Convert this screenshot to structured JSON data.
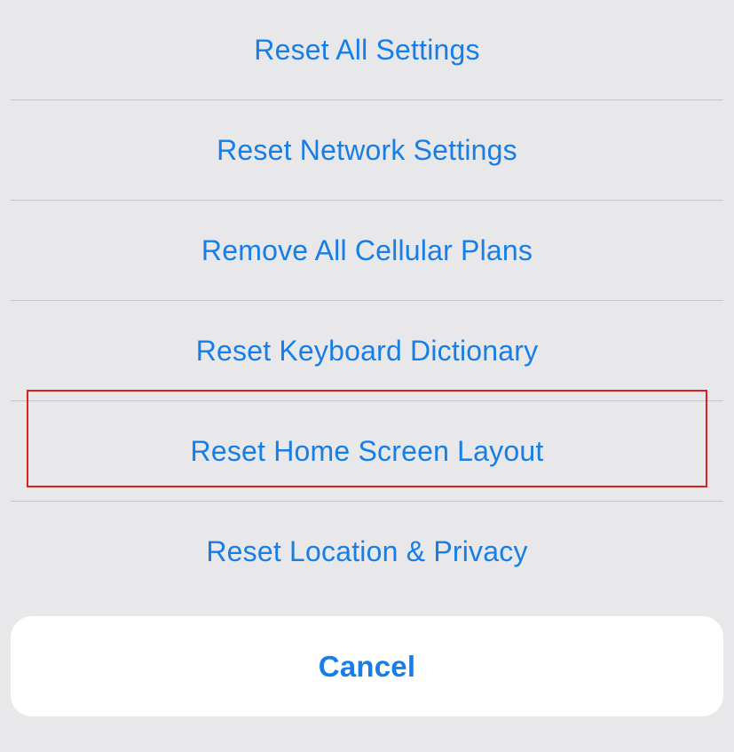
{
  "actions": {
    "reset_all_settings": "Reset All Settings",
    "reset_network_settings": "Reset Network Settings",
    "remove_all_cellular_plans": "Remove All Cellular Plans",
    "reset_keyboard_dictionary": "Reset Keyboard Dictionary",
    "reset_home_screen_layout": "Reset Home Screen Layout",
    "reset_location_privacy": "Reset Location & Privacy"
  },
  "cancel_label": "Cancel",
  "highlighted_action": "reset_home_screen_layout",
  "colors": {
    "ios_blue": "#167ee6",
    "highlight_red": "#d92020",
    "sheet_bg": "#e8e8ea",
    "divider": "#c7c7c9"
  }
}
